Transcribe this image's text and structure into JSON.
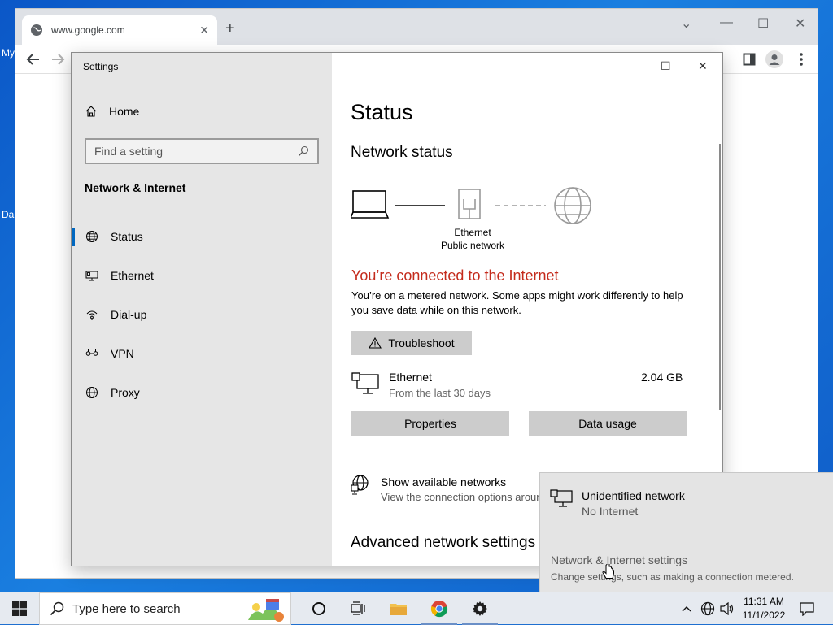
{
  "desktop": {
    "label_top": "My",
    "label_bottom": "Da"
  },
  "browser": {
    "tab_title": "www.google.com",
    "tab_close": "✕",
    "new_tab": "+",
    "controls": {
      "chevron": "⌄",
      "minimize": "—",
      "maximize": "☐",
      "close": "✕"
    }
  },
  "settings": {
    "window_title": "Settings",
    "home_label": "Home",
    "search_placeholder": "Find a setting",
    "section_title": "Network & Internet",
    "nav": [
      {
        "label": "Status",
        "icon": "status-globe-icon"
      },
      {
        "label": "Ethernet",
        "icon": "ethernet-icon"
      },
      {
        "label": "Dial-up",
        "icon": "dialup-icon"
      },
      {
        "label": "VPN",
        "icon": "vpn-icon"
      },
      {
        "label": "Proxy",
        "icon": "proxy-globe-icon"
      }
    ],
    "controls": {
      "minimize": "—",
      "maximize": "☐",
      "close": "✕"
    },
    "main": {
      "title": "Status",
      "network_status": "Network status",
      "diagram_label_line1": "Ethernet",
      "diagram_label_line2": "Public network",
      "connected_text": "You’re connected to the Internet",
      "metered_text": "You’re on a metered network. Some apps might work differently to help you save data while on this network.",
      "troubleshoot_label": "Troubleshoot",
      "usage_name": "Ethernet",
      "usage_period": "From the last 30 days",
      "usage_amount": "2.04 GB",
      "properties_label": "Properties",
      "data_usage_label": "Data usage",
      "show_networks_title": "Show available networks",
      "show_networks_desc": "View the connection options around",
      "advanced_title": "Advanced network settings"
    },
    "colors": {
      "accent": "#0067c0",
      "alert": "#c42b1c"
    }
  },
  "flyout": {
    "network_name": "Unidentified network",
    "network_status": "No Internet",
    "settings_link": "Network & Internet settings",
    "settings_desc": "Change settings, such as making a connection metered."
  },
  "taskbar": {
    "search_placeholder": "Type here to search",
    "time": "11:31 AM",
    "date": "11/1/2022"
  }
}
